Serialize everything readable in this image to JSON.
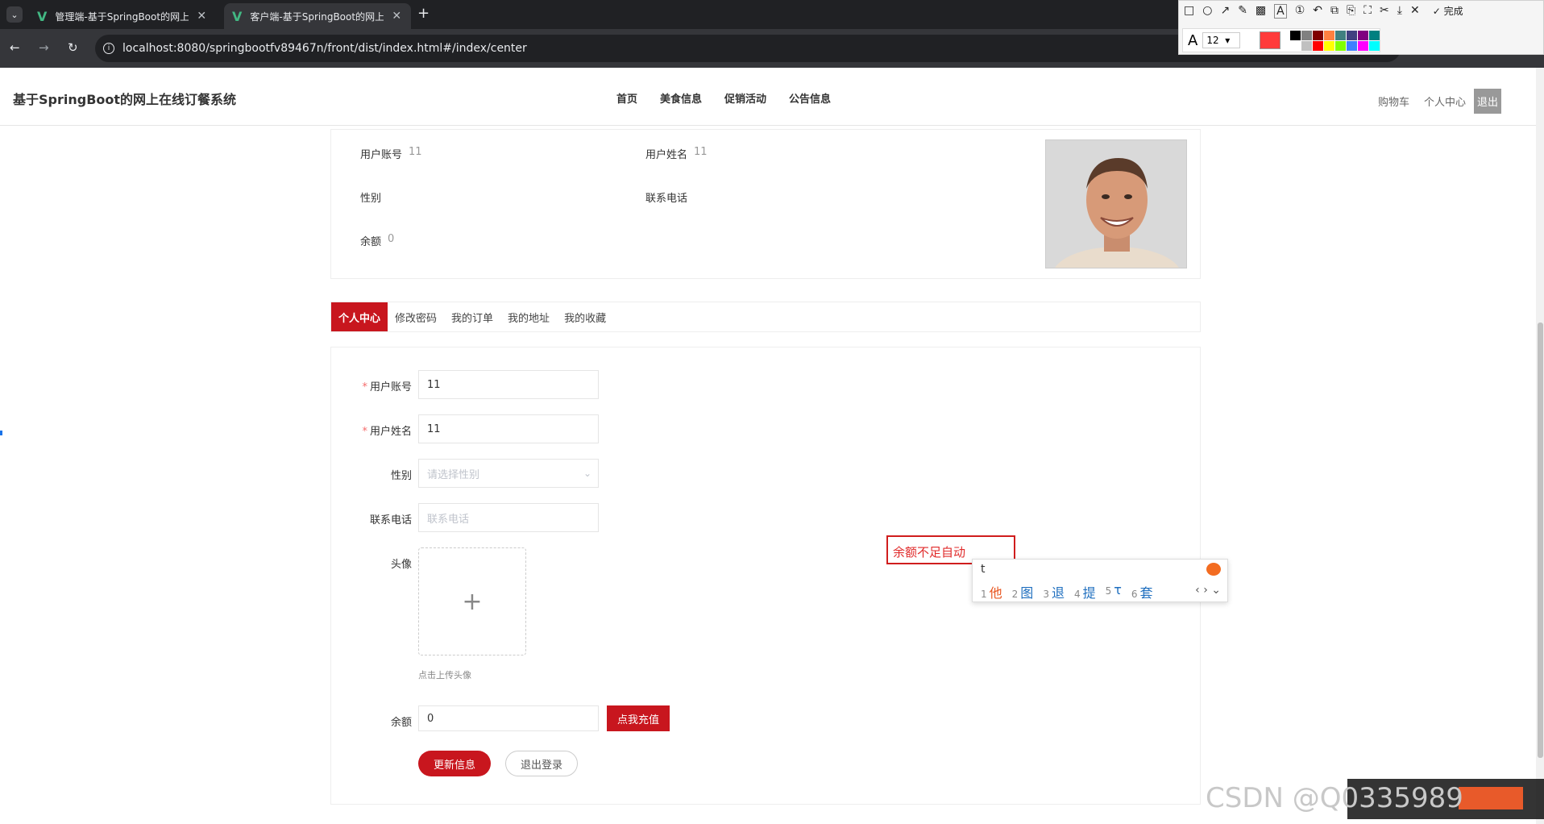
{
  "browser": {
    "tabs": [
      {
        "title": "管理端-基于SpringBoot的网上",
        "active": false
      },
      {
        "title": "客户端-基于SpringBoot的网上",
        "active": true
      }
    ],
    "new_tab": "+",
    "url": "localhost:8080/springbootfv89467n/front/dist/index.html#/index/center",
    "nav": {
      "back": "←",
      "forward": "→",
      "reload": "↻"
    }
  },
  "annotation_toolbar": {
    "tools": [
      "□",
      "○",
      "↗",
      "✎",
      "▩",
      "A",
      "①",
      "↶",
      "⧉",
      "⎘",
      "⛶",
      "✂",
      "⤓",
      "✕"
    ],
    "done_label": "完成",
    "font_icon": "A",
    "font_size": "12",
    "current_color": "#ff3b3b",
    "palette": [
      "#000000",
      "#808080",
      "#800000",
      "#ff8040",
      "#408080",
      "#404080",
      "#800080",
      "#008080",
      "#ffffff",
      "#c0c0c0",
      "#ff0000",
      "#ffff00",
      "#80ff00",
      "#4080ff",
      "#ff00ff",
      "#00ffff"
    ]
  },
  "header": {
    "site_title": "基于SpringBoot的网上在线订餐系统",
    "nav": [
      "首页",
      "美食信息",
      "促销活动",
      "公告信息"
    ],
    "right": {
      "cart": "购物车",
      "center": "个人中心",
      "logout": "退出"
    }
  },
  "profile": {
    "account_label": "用户账号",
    "account_value": "11",
    "name_label": "用户姓名",
    "name_value": "11",
    "gender_label": "性别",
    "gender_value": "",
    "phone_label": "联系电话",
    "phone_value": "",
    "balance_label": "余额",
    "balance_value": "0"
  },
  "tabs": [
    "个人中心",
    "修改密码",
    "我的订单",
    "我的地址",
    "我的收藏"
  ],
  "form": {
    "account": {
      "label": "用户账号",
      "value": "11",
      "required": "*"
    },
    "name": {
      "label": "用户姓名",
      "value": "11",
      "required": "*"
    },
    "gender": {
      "label": "性别",
      "placeholder": "请选择性别"
    },
    "phone": {
      "label": "联系电话",
      "placeholder": "联系电话"
    },
    "avatar": {
      "label": "头像",
      "plus": "+",
      "hint": "点击上传头像"
    },
    "balance": {
      "label": "余额",
      "value": "0",
      "recharge": "点我充值"
    },
    "update_btn": "更新信息",
    "logout_btn": "退出登录"
  },
  "overlay": {
    "annotation_text": "余额不足自动",
    "ime": {
      "typed": "t",
      "candidates": [
        {
          "n": "1",
          "c": "他"
        },
        {
          "n": "2",
          "c": "图"
        },
        {
          "n": "3",
          "c": "退"
        },
        {
          "n": "4",
          "c": "提"
        },
        {
          "n": "5",
          "c": "τ"
        },
        {
          "n": "6",
          "c": "套"
        }
      ],
      "arrows": "‹ › ⌄"
    },
    "watermark": "CSDN @Q0335989"
  }
}
